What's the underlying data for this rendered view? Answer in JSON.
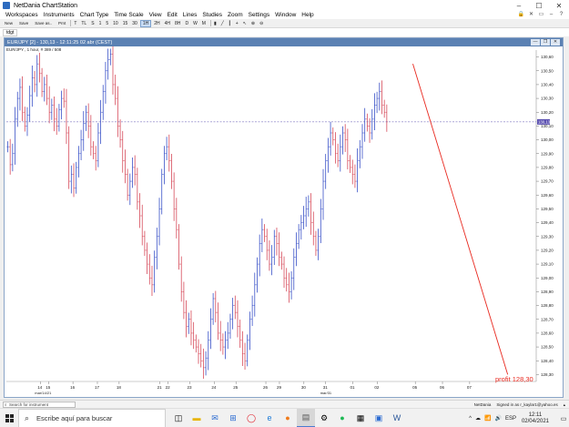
{
  "window": {
    "title": "NetDania ChartStation",
    "minimize": "–",
    "maximize": "☐",
    "close": "✕"
  },
  "menu": [
    "Workspaces",
    "Instruments",
    "Chart Type",
    "Time Scale",
    "View",
    "Edit",
    "Lines",
    "Studies",
    "Zoom",
    "Settings",
    "Window",
    "Help"
  ],
  "menu_right_icons": [
    "lock-icon",
    "close-doc-icon",
    "restore-doc-icon",
    "minimize-doc-icon",
    "help-icon"
  ],
  "toolbar": {
    "buttons": [
      "New",
      "Save",
      "Save as..",
      "Prnt"
    ],
    "timeframes": [
      "T",
      "TL",
      "S",
      "1",
      "5",
      "10",
      "15",
      "30",
      "1H",
      "2H",
      "4H",
      "8H",
      "D",
      "W",
      "M"
    ],
    "active_timeframe": "1H"
  },
  "tabs": [
    "tdgt"
  ],
  "chart": {
    "header": "EUR/JPY [2] - 130,13 - 12:11:25  02 abr (CEST)",
    "subheader": "EUR/JPY , 1 hour, # 389 / 508",
    "header_controls": [
      "—",
      "❐",
      "✕"
    ],
    "profit_label": "profit 128,30",
    "current_price": "130,13",
    "trendline_color": "#e8281e",
    "bar_color_up": "#3a52c8",
    "bar_color_down": "#d64a5a"
  },
  "chart_data": {
    "type": "bar",
    "title": "EUR/JPY , 1 hour",
    "y_ticks": [
      "130,60",
      "130,50",
      "130,40",
      "130,30",
      "130,20",
      "130,10",
      "130,00",
      "129,90",
      "129,80",
      "129,70",
      "129,60",
      "129,50",
      "129,40",
      "129,30",
      "129,20",
      "129,10",
      "129,00",
      "128,90",
      "128,80",
      "128,70",
      "128,60",
      "128,50",
      "128,40",
      "128,30"
    ],
    "ylim": [
      128.25,
      130.65
    ],
    "x_ticks": [
      "14",
      "15",
      "16",
      "17",
      "18",
      "21",
      "22",
      "23",
      "24",
      "25",
      "26",
      "29",
      "30",
      "31",
      "01",
      "02",
      "05",
      "06",
      "07"
    ],
    "x_sublabels": [
      {
        "tick": "14",
        "text": "mar/14/21"
      },
      {
        "tick": "31",
        "text": "mar/31"
      }
    ],
    "series": [
      {
        "values": [
          129.95,
          129.82,
          129.9,
          130.15,
          130.3,
          130.38,
          130.2,
          130.1,
          130.18,
          130.32,
          130.45,
          130.4,
          130.55,
          130.48,
          130.35,
          130.4,
          130.3,
          130.2,
          130.25,
          130.15,
          130.1,
          130.22,
          130.3,
          130.28,
          130.05,
          129.7,
          129.75,
          129.65,
          129.8,
          129.9,
          130.0,
          130.12,
          130.2,
          130.1,
          129.95,
          129.9,
          129.85,
          130.05,
          130.2,
          130.35,
          130.5,
          130.58,
          130.62,
          130.4,
          130.3,
          130.1,
          130.0,
          129.85,
          129.75,
          129.6,
          129.7,
          129.8,
          129.75,
          129.55,
          129.45,
          129.3,
          129.2,
          129.1,
          129.0,
          128.95,
          129.15,
          129.3,
          129.5,
          129.75,
          129.9,
          129.95,
          129.85,
          129.7,
          129.5,
          129.35,
          129.1,
          128.9,
          128.75,
          128.65,
          128.7,
          128.6,
          128.55,
          128.5,
          128.45,
          128.4,
          128.35,
          128.42,
          128.55,
          128.7,
          128.85,
          128.75,
          128.6,
          128.55,
          128.5,
          128.55,
          128.6,
          128.7,
          128.8,
          128.75,
          128.65,
          128.55,
          128.45,
          128.4,
          128.55,
          128.7,
          128.8,
          128.95,
          129.1,
          129.25,
          129.35,
          129.3,
          129.2,
          129.1,
          129.15,
          129.3,
          129.25,
          129.15,
          129.1,
          129.0,
          128.95,
          128.9,
          129.0,
          129.15,
          129.25,
          129.35,
          129.4,
          129.45,
          129.5,
          129.55,
          129.4,
          129.3,
          129.2,
          129.3,
          129.5,
          129.7,
          129.85,
          129.95,
          130.05,
          130.0,
          129.9,
          129.85,
          129.95,
          130.05,
          130.0,
          129.85,
          129.8,
          129.75,
          129.7,
          129.85,
          129.95,
          130.05,
          130.15,
          130.1,
          130.05,
          130.15,
          130.25,
          130.3,
          130.35,
          130.25,
          130.2,
          130.13
        ]
      }
    ],
    "trendline": {
      "from": {
        "x_index": 139,
        "y": 130.55
      },
      "to": {
        "x_index": 190,
        "y": 128.3
      }
    },
    "hline": 130.13,
    "grid": false
  },
  "statusbar": {
    "search_placeholder": "Search for instrument",
    "right_items": [
      "NetDania",
      "Signed in as r_kaylar1@yahoo.es",
      "▴"
    ]
  },
  "taskbar": {
    "search_text": "Escribe aquí para buscar",
    "icons": [
      "task-view-icon",
      "file-explorer-icon",
      "mail-icon",
      "store-icon",
      "opera-icon",
      "edge-icon",
      "firefox-icon",
      "chartstation-icon",
      "settings-icon",
      "spotify-icon",
      "calculator-icon",
      "photos-icon",
      "word-icon"
    ],
    "time": "12:11",
    "date": "02/04/2021",
    "tray_icons": [
      "^",
      "☁",
      "📶",
      "🔊",
      "ESP"
    ]
  }
}
